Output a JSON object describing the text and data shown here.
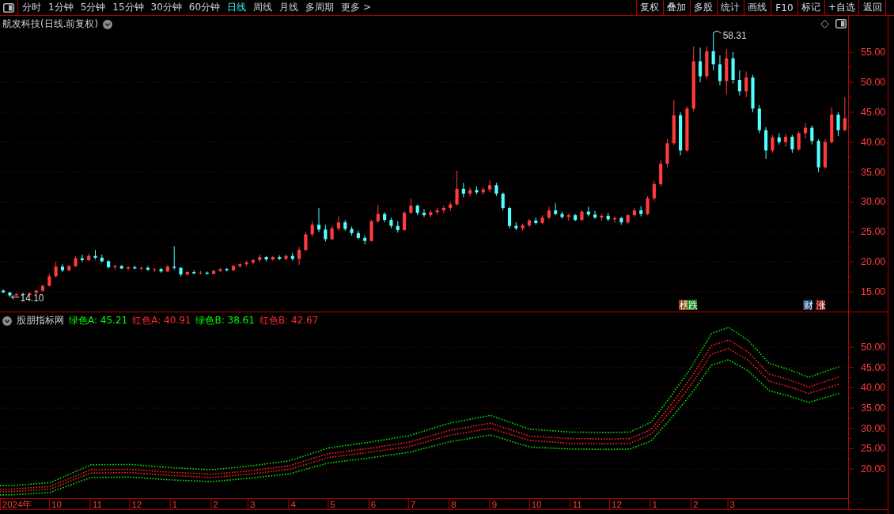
{
  "toolbar": {
    "periods": [
      {
        "label": "分时",
        "selected": false
      },
      {
        "label": "1分钟",
        "selected": false
      },
      {
        "label": "5分钟",
        "selected": false
      },
      {
        "label": "15分钟",
        "selected": false
      },
      {
        "label": "30分钟",
        "selected": false
      },
      {
        "label": "60分钟",
        "selected": false
      },
      {
        "label": "日线",
        "selected": true
      },
      {
        "label": "周线",
        "selected": false
      },
      {
        "label": "月线",
        "selected": false
      },
      {
        "label": "多周期",
        "selected": false
      },
      {
        "label": "更多 >",
        "selected": false
      }
    ],
    "actions": [
      "复权",
      "叠加",
      "多股",
      "统计",
      "画线",
      "F10",
      "标记",
      "+自选",
      "返回"
    ]
  },
  "price_panel": {
    "title": "航发科技(日线.前复权)",
    "events": [
      {
        "text": "榜",
        "color": "#8a4b08"
      },
      {
        "text": "跌",
        "color": "#16801c"
      },
      {
        "text": "财",
        "color": "#173a6e"
      },
      {
        "text": "涨",
        "color": "#7c0c0c"
      }
    ],
    "chart_data": [
      {
        "type": "candlestick",
        "ylim": [
          11.7,
          61.1
        ],
        "grid": true,
        "yticks": [
          {
            "value": 55,
            "label": "55.00"
          },
          {
            "value": 50,
            "label": "50.00"
          },
          {
            "value": 45,
            "label": "45.00"
          },
          {
            "value": 40,
            "label": "40.00"
          },
          {
            "value": 35,
            "label": "35.00"
          },
          {
            "value": 30,
            "label": "30.00"
          },
          {
            "value": 25,
            "label": "25.00"
          },
          {
            "value": 20,
            "label": "20.00"
          },
          {
            "value": 15,
            "label": "15.00"
          }
        ],
        "annotations": [
          "58.31",
          "14.10"
        ],
        "ohlc": [
          [
            15.2,
            15.4,
            14.8,
            14.9
          ],
          [
            14.9,
            15.0,
            14.1,
            14.4
          ],
          [
            14.4,
            14.8,
            14.3,
            14.6
          ],
          [
            14.6,
            14.9,
            14.4,
            14.5
          ],
          [
            14.5,
            14.9,
            14.4,
            14.8
          ],
          [
            14.8,
            15.3,
            14.7,
            15.2
          ],
          [
            15.2,
            16.2,
            15.0,
            16.0
          ],
          [
            16.0,
            18.0,
            15.9,
            17.6
          ],
          [
            17.6,
            20.0,
            17.4,
            19.2
          ],
          [
            19.2,
            19.6,
            18.3,
            18.6
          ],
          [
            18.6,
            19.5,
            18.4,
            19.3
          ],
          [
            19.3,
            21.0,
            19.1,
            20.6
          ],
          [
            20.6,
            21.2,
            20.0,
            20.3
          ],
          [
            20.3,
            21.4,
            20.1,
            21.0
          ],
          [
            21.0,
            22.0,
            20.4,
            20.7
          ],
          [
            20.7,
            21.2,
            19.9,
            20.1
          ],
          [
            20.1,
            20.3,
            18.9,
            19.1
          ],
          [
            19.1,
            19.5,
            18.7,
            19.3
          ],
          [
            19.3,
            19.5,
            18.8,
            18.9
          ],
          [
            18.9,
            19.3,
            18.6,
            19.1
          ],
          [
            19.1,
            19.4,
            18.8,
            18.9
          ],
          [
            18.9,
            19.2,
            18.6,
            19.0
          ],
          [
            19.0,
            19.3,
            18.5,
            18.7
          ],
          [
            18.7,
            19.0,
            18.3,
            18.8
          ],
          [
            18.8,
            19.0,
            18.2,
            18.4
          ],
          [
            18.4,
            19.5,
            18.3,
            19.2
          ],
          [
            19.2,
            22.6,
            18.7,
            19.0
          ],
          [
            19.0,
            19.1,
            17.6,
            17.9
          ],
          [
            17.9,
            18.5,
            17.7,
            18.3
          ],
          [
            18.3,
            18.6,
            17.9,
            18.1
          ],
          [
            18.1,
            18.5,
            17.9,
            18.2
          ],
          [
            18.2,
            18.4,
            17.9,
            18.0
          ],
          [
            18.0,
            18.6,
            17.9,
            18.5
          ],
          [
            18.5,
            19.0,
            18.3,
            18.8
          ],
          [
            18.8,
            19.0,
            18.4,
            18.6
          ],
          [
            18.6,
            19.5,
            18.5,
            19.3
          ],
          [
            19.3,
            19.8,
            19.0,
            19.6
          ],
          [
            19.6,
            20.2,
            19.3,
            19.9
          ],
          [
            19.9,
            20.5,
            19.6,
            20.3
          ],
          [
            20.3,
            21.2,
            20.0,
            20.8
          ],
          [
            20.8,
            21.0,
            20.1,
            20.4
          ],
          [
            20.4,
            21.0,
            20.2,
            20.8
          ],
          [
            20.8,
            21.1,
            20.3,
            20.5
          ],
          [
            20.5,
            21.2,
            20.3,
            21.0
          ],
          [
            21.0,
            21.5,
            20.2,
            20.5
          ],
          [
            20.5,
            22.5,
            19.5,
            22.0
          ],
          [
            22.0,
            25.0,
            21.8,
            24.6
          ],
          [
            24.6,
            26.8,
            24.2,
            26.2
          ],
          [
            26.2,
            29.0,
            25.0,
            25.4
          ],
          [
            25.4,
            26.2,
            23.4,
            23.8
          ],
          [
            23.8,
            26.0,
            23.6,
            25.6
          ],
          [
            25.6,
            27.6,
            25.2,
            26.6
          ],
          [
            26.6,
            27.0,
            25.2,
            25.5
          ],
          [
            25.5,
            25.9,
            24.4,
            24.8
          ],
          [
            24.8,
            25.2,
            23.8,
            24.0
          ],
          [
            24.0,
            24.4,
            22.9,
            23.5
          ],
          [
            23.5,
            27.0,
            23.4,
            26.8
          ],
          [
            26.8,
            29.5,
            26.5,
            28.0
          ],
          [
            28.0,
            28.3,
            26.6,
            27.0
          ],
          [
            27.0,
            27.4,
            25.6,
            26.0
          ],
          [
            26.0,
            26.8,
            24.9,
            25.3
          ],
          [
            25.3,
            28.5,
            25.2,
            28.2
          ],
          [
            28.2,
            30.6,
            28.0,
            29.4
          ],
          [
            29.4,
            29.6,
            27.8,
            28.2
          ],
          [
            28.2,
            28.8,
            27.5,
            27.8
          ],
          [
            27.8,
            28.6,
            27.4,
            28.3
          ],
          [
            28.3,
            29.0,
            27.9,
            28.6
          ],
          [
            28.6,
            29.4,
            28.1,
            29.0
          ],
          [
            29.0,
            30.0,
            28.5,
            29.6
          ],
          [
            29.6,
            35.2,
            29.4,
            32.2
          ],
          [
            32.2,
            33.2,
            30.8,
            31.4
          ],
          [
            31.4,
            32.4,
            30.9,
            32.0
          ],
          [
            32.0,
            32.6,
            31.3,
            31.6
          ],
          [
            31.6,
            32.5,
            31.2,
            32.1
          ],
          [
            32.1,
            33.6,
            31.6,
            32.8
          ],
          [
            32.8,
            33.2,
            31.0,
            31.4
          ],
          [
            31.4,
            31.6,
            28.6,
            29.0
          ],
          [
            29.0,
            29.2,
            25.6,
            26.0
          ],
          [
            26.0,
            26.6,
            25.3,
            25.6
          ],
          [
            25.6,
            26.4,
            25.2,
            26.1
          ],
          [
            26.1,
            27.2,
            25.8,
            26.9
          ],
          [
            26.9,
            27.4,
            26.2,
            26.5
          ],
          [
            26.5,
            27.8,
            26.3,
            27.4
          ],
          [
            27.4,
            29.2,
            27.1,
            28.6
          ],
          [
            28.6,
            29.8,
            27.8,
            28.0
          ],
          [
            28.0,
            28.4,
            27.2,
            27.5
          ],
          [
            27.5,
            28.1,
            26.9,
            27.8
          ],
          [
            27.8,
            28.0,
            26.8,
            27.0
          ],
          [
            27.0,
            28.6,
            26.8,
            28.4
          ],
          [
            28.4,
            29.2,
            27.6,
            27.9
          ],
          [
            27.9,
            28.5,
            27.2,
            27.4
          ],
          [
            27.4,
            28.0,
            26.9,
            27.7
          ],
          [
            27.7,
            28.2,
            26.8,
            27.1
          ],
          [
            27.1,
            27.6,
            26.5,
            27.3
          ],
          [
            27.3,
            27.5,
            26.2,
            26.6
          ],
          [
            26.6,
            28.0,
            26.3,
            27.8
          ],
          [
            27.8,
            29.0,
            27.5,
            28.6
          ],
          [
            28.6,
            29.3,
            27.6,
            28.0
          ],
          [
            28.0,
            31.0,
            27.8,
            30.6
          ],
          [
            30.6,
            33.5,
            30.2,
            33.0
          ],
          [
            33.0,
            37.0,
            32.6,
            36.4
          ],
          [
            36.4,
            40.5,
            35.8,
            39.8
          ],
          [
            39.8,
            47.0,
            39.5,
            44.5
          ],
          [
            44.5,
            45.0,
            37.8,
            38.6
          ],
          [
            38.6,
            46.0,
            38.4,
            45.6
          ],
          [
            45.6,
            56.0,
            45.2,
            53.5
          ],
          [
            53.5,
            55.8,
            50.0,
            51.0
          ],
          [
            51.0,
            56.0,
            50.6,
            55.2
          ],
          [
            55.2,
            58.31,
            52.0,
            53.0
          ],
          [
            53.0,
            54.5,
            49.5,
            50.2
          ],
          [
            50.2,
            55.5,
            48.0,
            54.0
          ],
          [
            54.0,
            55.0,
            49.8,
            50.4
          ],
          [
            50.4,
            52.0,
            47.8,
            48.5
          ],
          [
            48.5,
            51.8,
            47.5,
            50.8
          ],
          [
            50.8,
            51.2,
            45.0,
            45.6
          ],
          [
            45.6,
            46.2,
            41.5,
            42.0
          ],
          [
            42.0,
            42.5,
            37.2,
            38.6
          ],
          [
            38.6,
            41.2,
            38.2,
            40.8
          ],
          [
            40.8,
            41.5,
            39.6,
            40.0
          ],
          [
            40.0,
            41.4,
            39.2,
            40.9
          ],
          [
            40.9,
            41.2,
            38.2,
            38.8
          ],
          [
            38.8,
            41.8,
            38.5,
            41.5
          ],
          [
            41.5,
            43.2,
            40.6,
            42.4
          ],
          [
            42.4,
            42.8,
            39.6,
            40.2
          ],
          [
            40.2,
            40.5,
            35.0,
            35.8
          ],
          [
            35.8,
            40.5,
            35.6,
            40.0
          ],
          [
            40.0,
            45.8,
            39.8,
            44.6
          ],
          [
            44.6,
            45.0,
            41.0,
            42.0
          ],
          [
            42.0,
            47.5,
            41.8,
            44.0
          ]
        ]
      }
    ]
  },
  "indicator_panel": {
    "name": "股朋指标网",
    "readings": [
      {
        "text": "绿色A: 45.21",
        "color": "#00ff00"
      },
      {
        "text": "红色A: 40.91",
        "color": "#ff2a2a"
      },
      {
        "text": "绿色B: 38.61",
        "color": "#00ff00"
      },
      {
        "text": "红色B: 42.67",
        "color": "#ff2a2a"
      }
    ],
    "chart_data": [
      {
        "type": "line",
        "line_style": "dotted",
        "grid": true,
        "xlim": [
          "2024-08-24",
          "2026-05-31"
        ],
        "ylim": [
          12.8,
          58.6
        ],
        "yticks": [
          {
            "value": 50,
            "label": "50.00"
          },
          {
            "value": 45,
            "label": "45.00"
          },
          {
            "value": 40,
            "label": "40.00"
          },
          {
            "value": 35,
            "label": "35.00"
          },
          {
            "value": 30,
            "label": "30.00"
          },
          {
            "value": 25,
            "label": "25.00"
          },
          {
            "value": 20,
            "label": "20.00"
          }
        ],
        "xticks": [
          {
            "value": "2024-09-06",
            "label": "2024年"
          },
          {
            "value": "2024-10-06",
            "label": "10"
          },
          {
            "value": "2024-11-06",
            "label": "11"
          },
          {
            "value": "2024-12-06",
            "label": "12"
          },
          {
            "value": "2025-01-04",
            "label": "1"
          },
          {
            "value": "2025-02-04",
            "label": "2"
          },
          {
            "value": "2025-03-04",
            "label": "3"
          },
          {
            "value": "2025-04-04",
            "label": "4"
          },
          {
            "value": "2025-05-04",
            "label": "5"
          },
          {
            "value": "2025-06-04",
            "label": "6"
          },
          {
            "value": "2025-07-04",
            "label": "7"
          },
          {
            "value": "2025-08-04",
            "label": "8"
          },
          {
            "value": "2025-09-04",
            "label": "9"
          },
          {
            "value": "2025-10-06",
            "label": "10"
          },
          {
            "value": "2025-11-06",
            "label": "11"
          },
          {
            "value": "2025-12-06",
            "label": "12"
          },
          {
            "value": "2026-01-04",
            "label": "1"
          },
          {
            "value": "2026-02-04",
            "label": "2"
          },
          {
            "value": "2026-03-04",
            "label": "3"
          }
        ],
        "x": [
          "2024-08-24",
          "2024-09-01",
          "2024-10-01",
          "2024-11-01",
          "2024-12-01",
          "2025-01-01",
          "2025-02-01",
          "2025-03-01",
          "2025-04-01",
          "2025-05-01",
          "2025-06-01",
          "2025-07-01",
          "2025-08-01",
          "2025-09-01",
          "2025-10-01",
          "2025-11-01",
          "2025-12-01",
          "2025-12-16",
          "2026-01-01",
          "2026-01-16",
          "2026-02-01",
          "2026-02-16",
          "2026-03-01",
          "2026-03-16",
          "2026-04-01",
          "2026-04-16",
          "2026-05-01",
          "2026-05-24"
        ],
        "series": [
          {
            "color": "#00e800",
            "values": [
              15.9,
              15.9,
              16.6,
              21.0,
              21.1,
              20.3,
              19.8,
              20.7,
              22.0,
              25.2,
              26.6,
              28.2,
              31.3,
              33.2,
              29.8,
              29.1,
              29.0,
              29.1,
              31.5,
              37.8,
              45.2,
              53.4,
              54.9,
              51.7,
              46.0,
              44.5,
              42.6,
              45.2
            ]
          },
          {
            "color": "#ff2020",
            "values": [
              14.4,
              14.4,
              15.0,
              19.0,
              19.1,
              18.4,
              17.9,
              18.7,
              19.9,
              22.8,
              24.1,
              25.5,
              28.3,
              30.0,
              27.0,
              26.3,
              26.2,
              26.3,
              28.5,
              34.2,
              40.9,
              48.3,
              49.7,
              46.8,
              41.6,
              40.3,
              38.6,
              40.9
            ]
          },
          {
            "color": "#00e800",
            "values": [
              13.6,
              13.6,
              14.2,
              17.9,
              18.0,
              17.3,
              16.9,
              17.7,
              18.8,
              21.5,
              22.7,
              24.1,
              26.7,
              28.4,
              25.4,
              24.9,
              24.8,
              24.9,
              26.9,
              32.3,
              38.6,
              45.6,
              46.9,
              44.2,
              39.3,
              38.0,
              36.4,
              38.6
            ]
          },
          {
            "color": "#ff2020",
            "values": [
              15.0,
              15.0,
              15.7,
              19.8,
              19.9,
              19.2,
              18.7,
              19.5,
              20.8,
              23.8,
              25.1,
              26.6,
              29.5,
              31.3,
              28.1,
              27.5,
              27.4,
              27.5,
              29.7,
              35.7,
              42.7,
              50.4,
              51.8,
              48.8,
              43.4,
              42.0,
              40.2,
              42.7
            ]
          }
        ]
      }
    ]
  }
}
